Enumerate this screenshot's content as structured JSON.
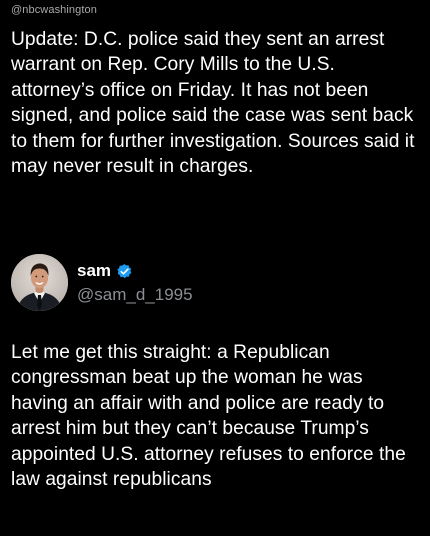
{
  "watermark": {
    "handle": "@nbcwashington"
  },
  "quoted_post": {
    "text": "Update: D.C. police said they sent an arrest warrant on Rep. Cory Mills to the U.S. attorney’s office on Friday. It has not been signed, and police said the case was sent back to them for further investigation. Sources said it may never result in charges."
  },
  "author": {
    "display_name": "sam",
    "handle": "@sam_d_1995",
    "verified": true,
    "verified_color": "#1d9bf0"
  },
  "post": {
    "text": "Let me get this straight: a Republican congressman beat up the woman he was having an affair with and police are ready to arrest him but they can’t because Trump’s appointed U.S. attorney refuses to enforce the law against republicans"
  },
  "colors": {
    "background": "#000000",
    "primary_text": "#ffffff",
    "secondary_text": "#8b8f93"
  },
  "icons": {
    "verified": "verified-badge-icon",
    "avatar": "avatar-photo"
  }
}
